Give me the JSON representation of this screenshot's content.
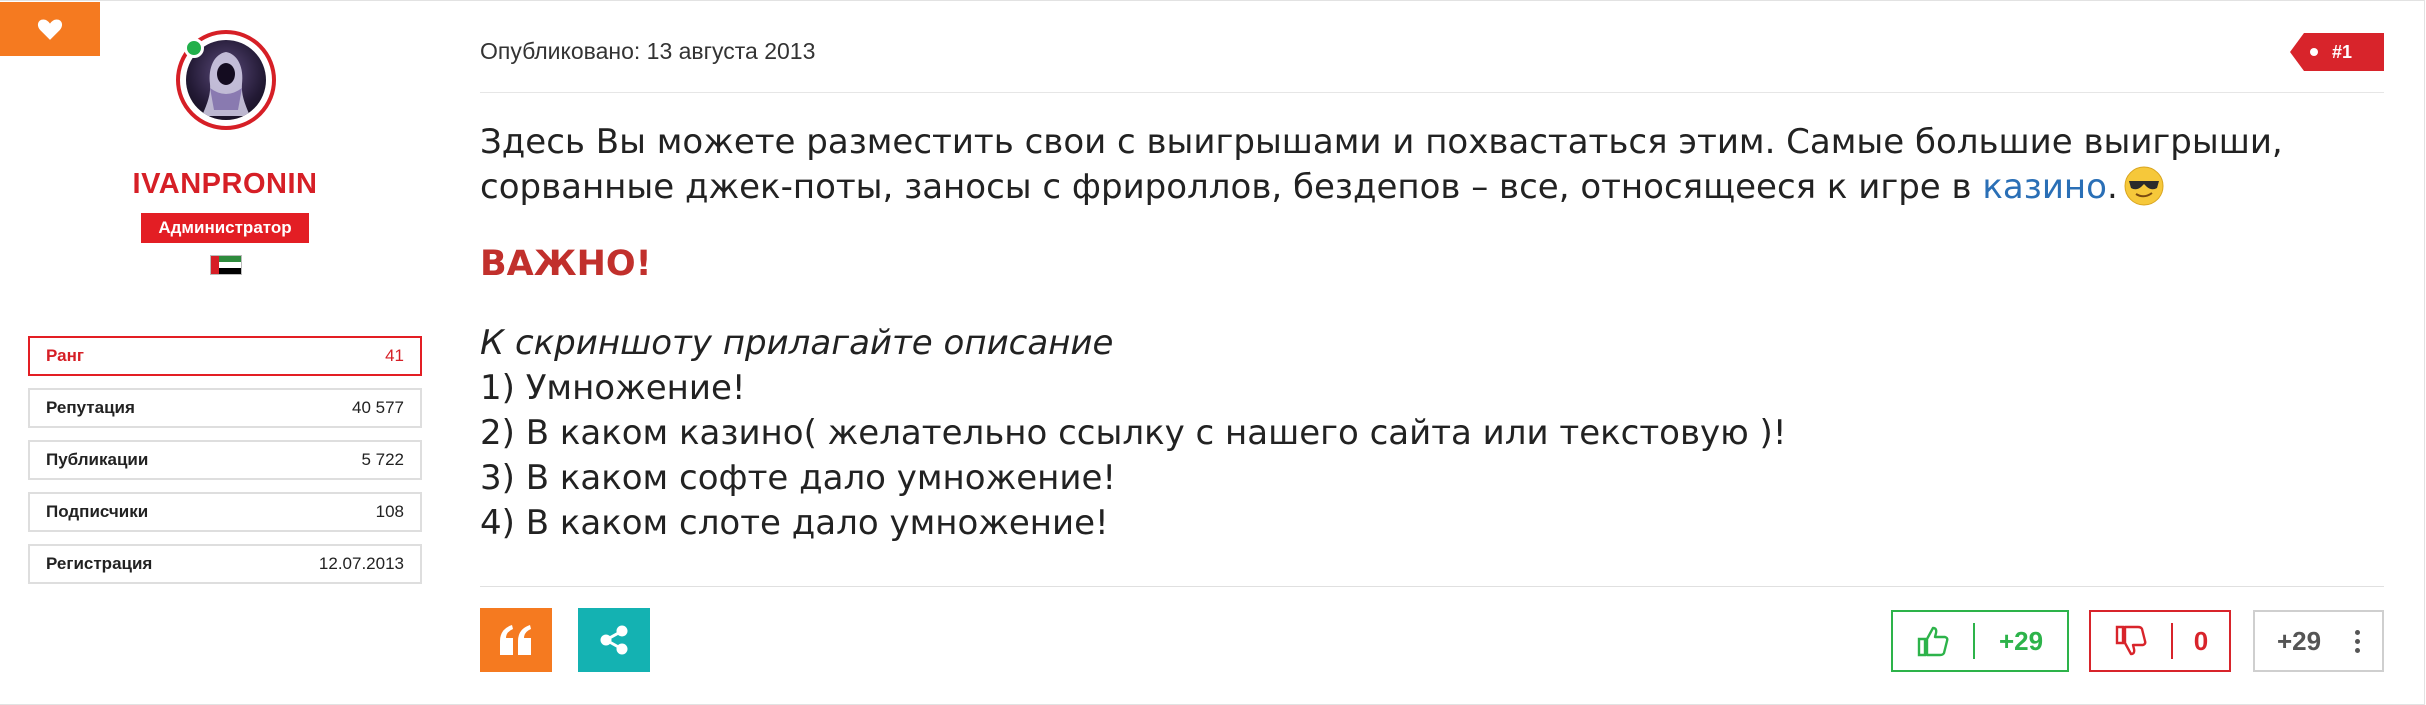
{
  "author": {
    "username": "IVANPRONIN",
    "role": "Администратор",
    "online": true,
    "stats": [
      {
        "label": "Ранг",
        "value": "41"
      },
      {
        "label": "Репутация",
        "value": "40 577"
      },
      {
        "label": "Публикации",
        "value": "5 722"
      },
      {
        "label": "Подписчики",
        "value": "108"
      },
      {
        "label": "Регистрация",
        "value": "12.07.2013"
      }
    ]
  },
  "post": {
    "published": "Опубликовано: 13 августа 2013",
    "number": "#1",
    "intro_text": "Здесь Вы можете разместить свои с выигрышами и похвастаться этим. Самые большие выигрыши, сорванные джек-поты, заносы с фрироллов, бездепов – все, относящееся к игре в ",
    "intro_link": "казино",
    "intro_end": ".",
    "important": "ВАЖНО!",
    "instruction": "К скриншоту прилагайте описание",
    "list": [
      "1) Умножение!",
      "2) В каком казино( желательно ссылку с нашего сайта или текстовую )!",
      "3) В каком софте дало умножение!",
      "4) В каком слоте дало умножение!"
    ]
  },
  "actions": {
    "likes": "+29",
    "dislikes": "0",
    "reputation": "+29"
  },
  "colors": {
    "accent_orange": "#f57a20",
    "accent_red": "#e31e24",
    "share_teal": "#14b2b2",
    "like_green": "#2db34a",
    "link_blue": "#2a6fb6"
  },
  "icons": [
    "heart-icon",
    "quote-icon",
    "share-icon",
    "thumbs-up-icon",
    "thumbs-down-icon",
    "more-vertical-icon",
    "sunglasses-emoji"
  ]
}
